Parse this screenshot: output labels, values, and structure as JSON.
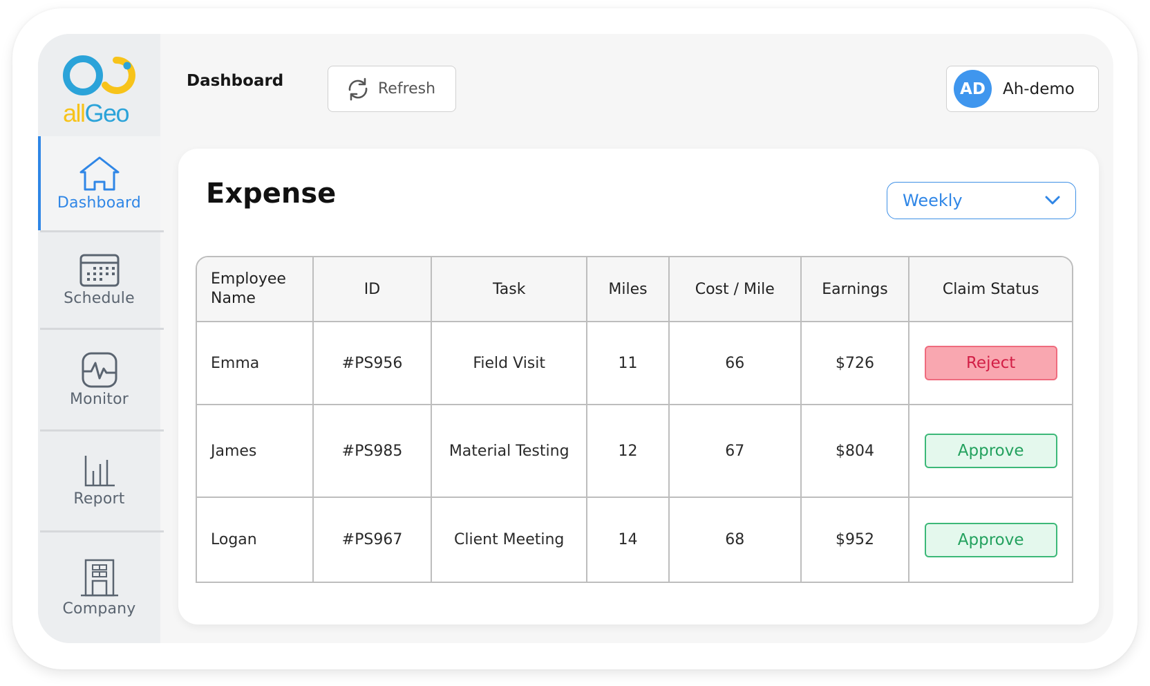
{
  "brand": {
    "logo_part1": "all",
    "logo_part2": "Geo"
  },
  "sidebar": {
    "items": [
      {
        "label": "Dashboard",
        "icon": "home-icon",
        "active": true
      },
      {
        "label": "Schedule",
        "icon": "calendar-icon",
        "active": false
      },
      {
        "label": "Monitor",
        "icon": "pulse-monitor-icon",
        "active": false
      },
      {
        "label": "Report",
        "icon": "bar-chart-icon",
        "active": false
      },
      {
        "label": "Company",
        "icon": "building-icon",
        "active": false
      }
    ]
  },
  "header": {
    "title": "Dashboard",
    "refresh_label": "Refresh",
    "user": {
      "initials": "AD",
      "name": "Ah-demo"
    }
  },
  "expense": {
    "title": "Expense",
    "period_selected": "Weekly",
    "columns": [
      "Employee Name",
      "ID",
      "Task",
      "Miles",
      "Cost / Mile",
      "Earnings",
      "Claim Status"
    ],
    "rows": [
      {
        "name": "Emma",
        "id": "#PS956",
        "task": "Field Visit",
        "miles": "11",
        "cost_per_mile": "66",
        "earnings": "$726",
        "status": "Reject"
      },
      {
        "name": "James",
        "id": "#PS985",
        "task": "Material Testing",
        "miles": "12",
        "cost_per_mile": "67",
        "earnings": "$804",
        "status": "Approve"
      },
      {
        "name": "Logan",
        "id": "#PS967",
        "task": "Client Meeting",
        "miles": "14",
        "cost_per_mile": "68",
        "earnings": "$952",
        "status": "Approve"
      }
    ]
  },
  "colors": {
    "accent_blue": "#2f86e6",
    "reject_bg": "#f9a7b0",
    "reject_text": "#d21f46",
    "approve_bg": "#e4f8ed",
    "approve_text": "#23a15e",
    "logo_blue": "#2ba3d9",
    "logo_yellow": "#f7c31a"
  }
}
